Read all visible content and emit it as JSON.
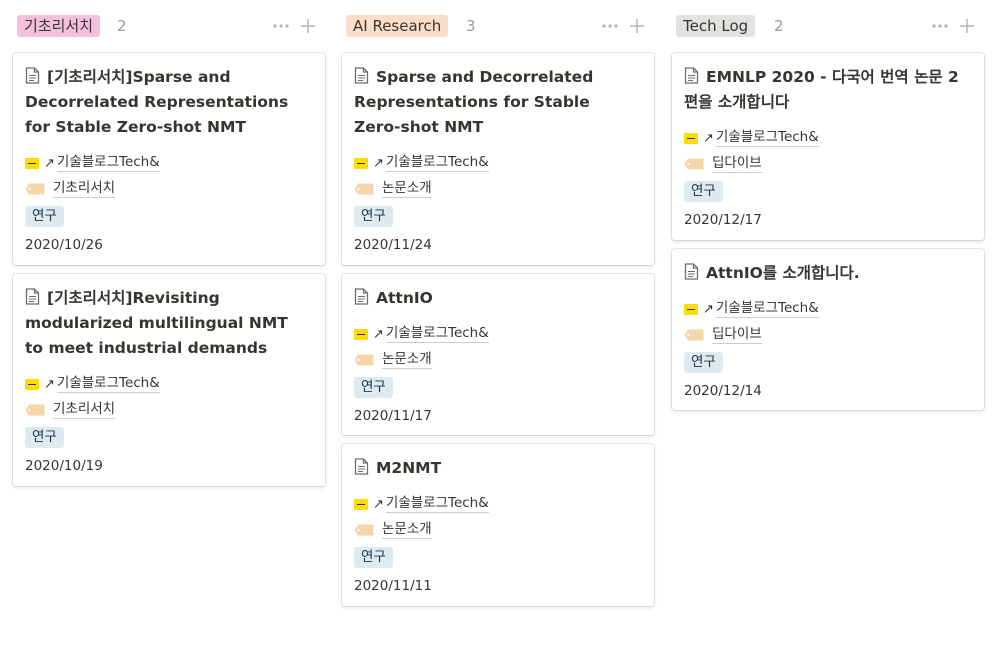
{
  "colors": {
    "tag_research_bg": "#f5c0dd",
    "tag_ai_bg": "#fadec9",
    "tag_tech_bg": "#e3e2e0",
    "pill_bg": "#ddebf1",
    "tech_logo": "#ffdd00",
    "tag_icon": "#f4d6a8"
  },
  "icons": {
    "card": "document-icon",
    "source": "tech-logo-icon",
    "author": "name-tag-icon",
    "more": "more-dots-icon",
    "add": "plus-icon"
  },
  "columns": [
    {
      "title": "기초리서치",
      "count": "2",
      "cards": [
        {
          "title": "[기초리서치]Sparse and Decorrelated Representations for Stable Zero-shot NMT",
          "arrow": "↗",
          "source": "기술블로그Tech&",
          "author": "기초리서치",
          "category": "연구",
          "date": "2020/10/26"
        },
        {
          "title": "[기초리서치]Revisiting modularized multilingual NMT to meet industrial demands",
          "arrow": "↗",
          "source": "기술블로그Tech&",
          "author": "기초리서치",
          "category": "연구",
          "date": "2020/10/19"
        }
      ]
    },
    {
      "title": "AI Research",
      "count": "3",
      "cards": [
        {
          "title": "Sparse and Decorrelated Representations for Stable Zero-shot NMT",
          "arrow": "↗",
          "source": "기술블로그Tech&",
          "author": "논문소개",
          "category": "연구",
          "date": "2020/11/24"
        },
        {
          "title": "AttnIO",
          "arrow": "↗",
          "source": "기술블로그Tech&",
          "author": "논문소개",
          "category": "연구",
          "date": "2020/11/17"
        },
        {
          "title": "M2NMT",
          "arrow": "↗",
          "source": "기술블로그Tech&",
          "author": "논문소개",
          "category": "연구",
          "date": "2020/11/11"
        }
      ]
    },
    {
      "title": "Tech Log",
      "count": "2",
      "cards": [
        {
          "title": "EMNLP 2020 - 다국어 번역 논문 2편을 소개합니다",
          "arrow": "↗",
          "source": "기술블로그Tech&",
          "author": "딥다이브",
          "category": "연구",
          "date": "2020/12/17"
        },
        {
          "title": "AttnIO를 소개합니다.",
          "arrow": "↗",
          "source": "기술블로그Tech&",
          "author": "딥다이브",
          "category": "연구",
          "date": "2020/12/14"
        }
      ]
    }
  ]
}
